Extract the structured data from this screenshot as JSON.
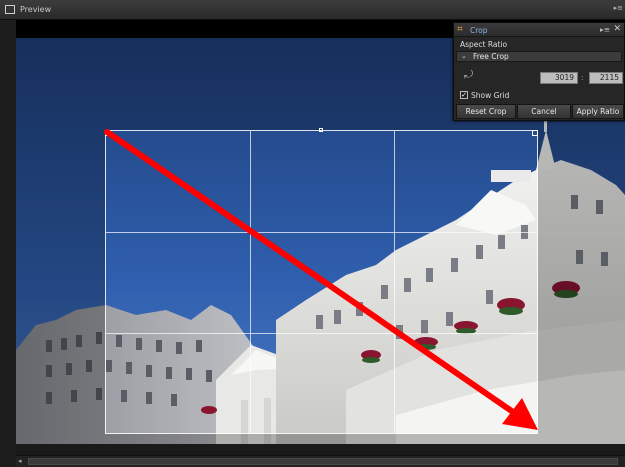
{
  "window": {
    "title": "Preview",
    "panel_menu_icon": "panel-menu-icon"
  },
  "crop_panel": {
    "title": "Crop",
    "aspect_ratio_label": "Aspect Ratio",
    "aspect_ratio_value": "Free Crop",
    "width_value": "3019",
    "height_value": "2115",
    "ratio_separator": ":",
    "show_grid_label": "Show Grid",
    "show_grid_checked": true,
    "buttons": {
      "reset": "Reset Crop",
      "cancel": "Cancel",
      "apply": "Apply Ratio"
    }
  },
  "annotation": {
    "arrow_color": "#ff0000"
  },
  "scrollbar": {
    "arrow": "◂"
  }
}
